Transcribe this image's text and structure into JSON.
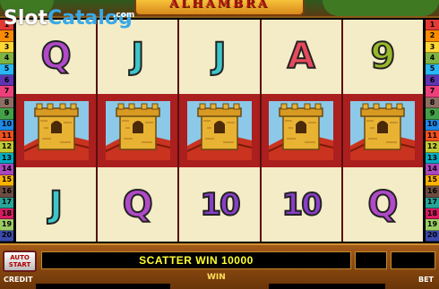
{
  "watermark": {
    "part1": "Slot",
    "part2": "Catalog",
    "suffix": ".com"
  },
  "title": "ALHAMBRA",
  "paylines": [
    1,
    2,
    3,
    4,
    5,
    6,
    7,
    8,
    9,
    10,
    11,
    12,
    13,
    14,
    15,
    16,
    17,
    18,
    19,
    20
  ],
  "payline_colors": [
    "#e53935",
    "#fb8c00",
    "#fdd835",
    "#7cb342",
    "#29b6f6",
    "#5e35b1",
    "#ec407a",
    "#8d6e63",
    "#43a047",
    "#1e88e5",
    "#f4511e",
    "#c0ca33",
    "#00acc1",
    "#ab47bc",
    "#ffb300",
    "#6d4c41",
    "#26a69a",
    "#d81b60",
    "#9ccc65",
    "#3949ab"
  ],
  "reels": [
    [
      "Q",
      "tower",
      "J"
    ],
    [
      "J",
      "tower",
      "Q"
    ],
    [
      "J",
      "tower",
      "10"
    ],
    [
      "A",
      "tower",
      "10"
    ],
    [
      "9",
      "tower",
      "Q"
    ]
  ],
  "symbol_colors": {
    "Q": "#b04ac8",
    "J": "#3dc6c8",
    "A": "#e64a5c",
    "9": "#9ab82a",
    "10": "#8a3ec8"
  },
  "panel": {
    "auto_start_line1": "AUTO",
    "auto_start_line2": "START",
    "message": "SCATTER WIN 10000",
    "credit_label": "CREDIT",
    "win_label": "WIN",
    "bet_label": "BET"
  }
}
